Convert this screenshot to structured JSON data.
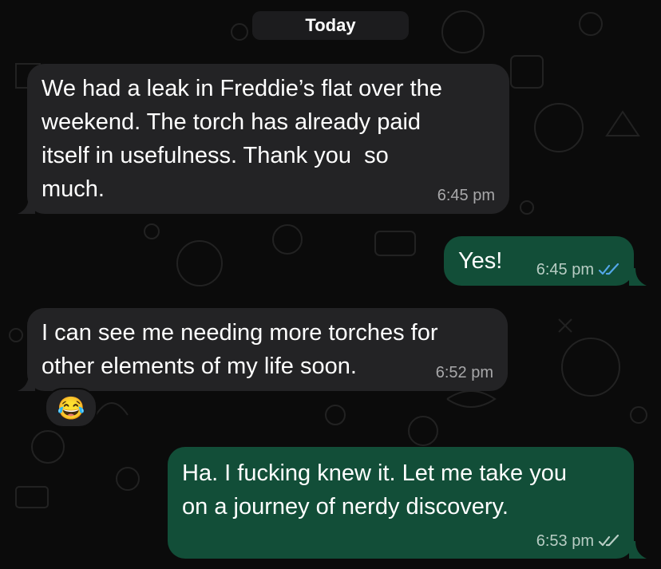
{
  "day_divider": "Today",
  "messages": [
    {
      "direction": "incoming",
      "text": "We had a leak in Freddie’s flat over the\nweekend. The torch has already paid\nitself in usefulness. Thank you  so\nmuch.",
      "time": "6:45 pm"
    },
    {
      "direction": "outgoing",
      "text": "Yes!",
      "time": "6:45 pm",
      "status": "read",
      "tick_color": "#53a7e8"
    },
    {
      "direction": "incoming",
      "text": "I can see me needing more torches for\nother elements of my life soon.",
      "time": "6:52 pm",
      "reaction": "😂"
    },
    {
      "direction": "outgoing",
      "text": "Ha. I fucking knew it. Let me take you\non a journey of nerdy discovery.",
      "time": "6:53 pm",
      "status": "delivered",
      "tick_color": "#b8cdc4"
    }
  ],
  "colors": {
    "background": "#0b0b0b",
    "incoming_bubble": "#232325",
    "outgoing_bubble": "#124e38",
    "read_tick": "#53a7e8"
  }
}
